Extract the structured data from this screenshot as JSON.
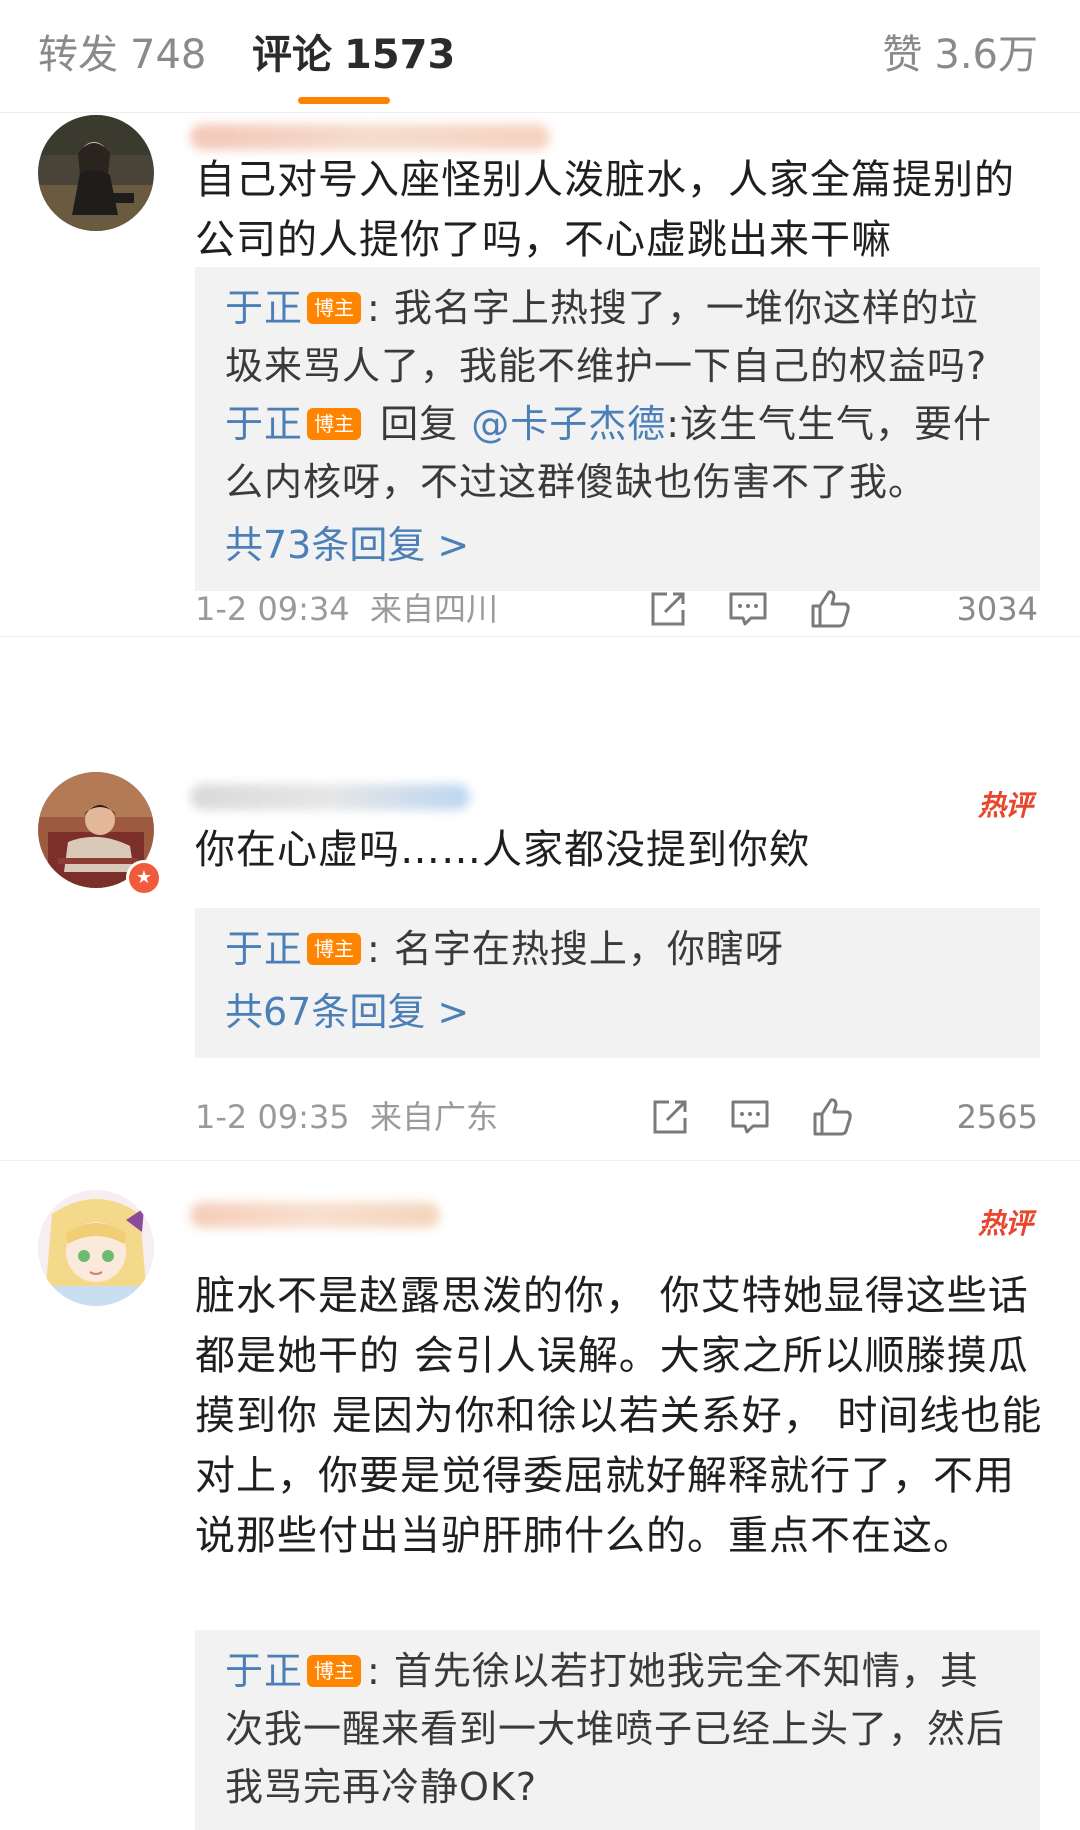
{
  "tabs": {
    "repost_label": "转发",
    "repost_count": "748",
    "comment_label": "评论",
    "comment_count": "1573",
    "like_label": "赞",
    "like_count": "3.6万"
  },
  "comments": [
    {
      "text": "自己对号入座怪别人泼脏水，人家全篇提别的公司的人提你了吗，不心虚跳出来干嘛",
      "replies": [
        {
          "author": "于正",
          "badge": "博主",
          "sep": ":",
          "text": "我名字上热搜了，一堆你这样的垃圾来骂人了，我能不维护一下自己的权益吗?"
        },
        {
          "author": "于正",
          "badge": "博主",
          "reply_word": "回复",
          "reply_to": "@卡子杰德",
          "sep": ":",
          "text": "该生气生气，要什么内核呀，不过这群傻缺也伤害不了我。"
        }
      ],
      "more_replies": "共73条回复 >",
      "time": "1-2 09:34",
      "location": "来自四川",
      "likes": "3034"
    },
    {
      "hot_badge": "热评",
      "text": "你在心虚吗……人家都没提到你欸",
      "replies": [
        {
          "author": "于正",
          "badge": "博主",
          "sep": ":",
          "text": "名字在热搜上，你瞎呀"
        }
      ],
      "more_replies": "共67条回复 >",
      "time": "1-2 09:35",
      "location": "来自广东",
      "likes": "2565"
    },
    {
      "hot_badge": "热评",
      "text": "脏水不是赵露思泼的你， 你艾特她显得这些话都是她干的 会引人误解。大家之所以顺滕摸瓜摸到你 是因为你和徐以若关系好， 时间线也能对上，你要是觉得委屈就好解释就行了，不用说那些付出当驴肝肺什么的。重点不在这。",
      "replies": [
        {
          "author": "于正",
          "badge": "博主",
          "sep": ":",
          "text": "首先徐以若打她我完全不知情，其次我一醒来看到一大堆喷子已经上头了，然后我骂完再冷静OK?"
        }
      ]
    }
  ],
  "icons": {
    "share": "share-icon",
    "comment": "comment-icon",
    "like": "thumbs-up-icon"
  },
  "colors": {
    "accent": "#ff8200",
    "link": "#4a7fb7",
    "hot": "#e8462d",
    "reply_bg": "#f2f2f2"
  }
}
